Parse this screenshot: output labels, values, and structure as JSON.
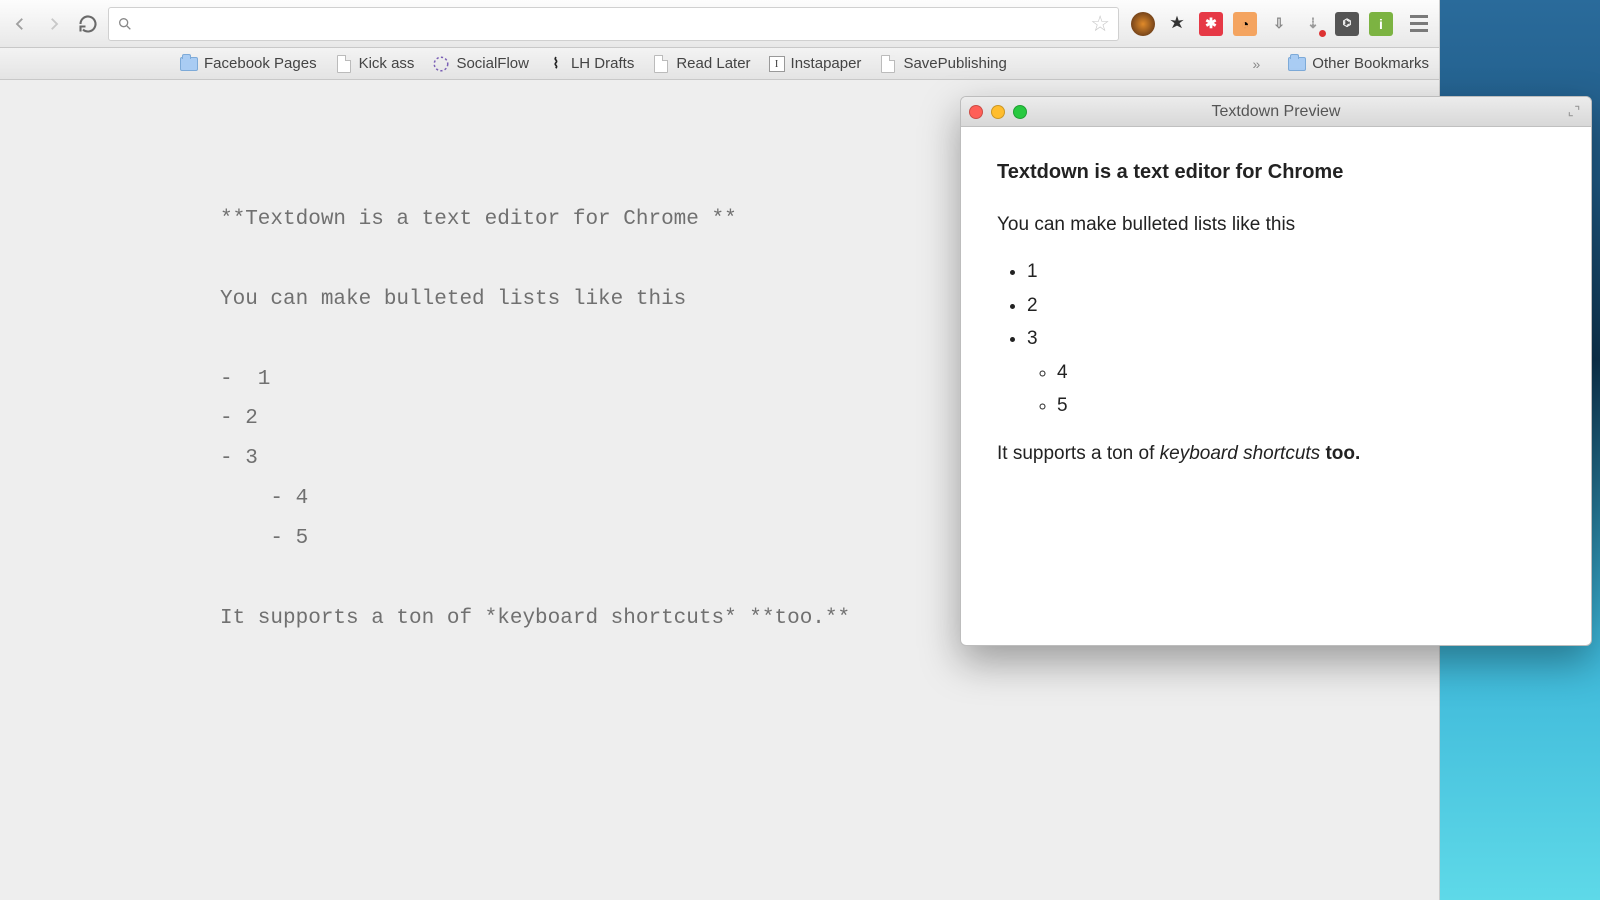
{
  "bookmarks": [
    {
      "icon": "folder",
      "label": "Facebook Pages"
    },
    {
      "icon": "page",
      "label": "Kick ass"
    },
    {
      "icon": "social",
      "label": "SocialFlow"
    },
    {
      "icon": "lh",
      "label": "LH Drafts"
    },
    {
      "icon": "page",
      "label": "Read Later"
    },
    {
      "icon": "insta",
      "label": "Instapaper"
    },
    {
      "icon": "page",
      "label": "SavePublishing"
    }
  ],
  "bookmarks_overflow": "»",
  "other_bookmarks": "Other Bookmarks",
  "editor_lines": [
    "**Textdown is a text editor for Chrome **",
    "",
    "You can make bulleted lists like this",
    "",
    "-  1",
    "- 2",
    "- 3",
    "    - 4",
    "    - 5",
    "",
    "It supports a ton of *keyboard shortcuts* **too.**"
  ],
  "preview": {
    "title": "Textdown Preview",
    "heading": "Textdown is a text editor for Chrome",
    "intro": "You can make bulleted lists like this",
    "list": [
      "1",
      "2",
      "3"
    ],
    "sublist": [
      "4",
      "5"
    ],
    "footer_prefix": "It supports a ton of ",
    "footer_em": "keyboard shortcuts",
    "footer_strong": " too."
  }
}
